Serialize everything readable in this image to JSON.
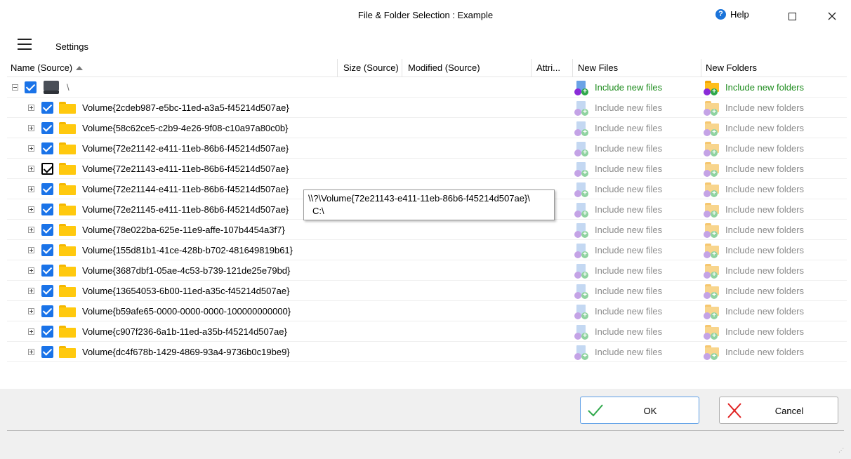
{
  "window": {
    "title": "File & Folder Selection : Example",
    "help_label": "Help"
  },
  "toolbar": {
    "settings_label": "Settings"
  },
  "columns": {
    "name": "Name (Source)",
    "size": "Size (Source)",
    "modified": "Modified (Source)",
    "attributes": "Attri...",
    "new_files": "New Files",
    "new_folders": "New Folders"
  },
  "root": {
    "name": "\\",
    "include_files": "Include new files",
    "include_folders": "Include new folders"
  },
  "rows": [
    {
      "name": "Volume{2cdeb987-e5bc-11ed-a3a5-f45214d507ae}",
      "files": "Include new files",
      "folders": "Include new folders"
    },
    {
      "name": "Volume{58c62ce5-c2b9-4e26-9f08-c10a97a80c0b}",
      "files": "Include new files",
      "folders": "Include new folders"
    },
    {
      "name": "Volume{72e21142-e411-11eb-86b6-f45214d507ae}",
      "files": "Include new files",
      "folders": "Include new folders"
    },
    {
      "name": "Volume{72e21143-e411-11eb-86b6-f45214d507ae}",
      "files": "Include new files",
      "folders": "Include new folders"
    },
    {
      "name": "Volume{72e21144-e411-11eb-86b6-f45214d507ae}",
      "files": "Include new files",
      "folders": "Include new folders"
    },
    {
      "name": "Volume{72e21145-e411-11eb-86b6-f45214d507ae}",
      "files": "Include new files",
      "folders": "Include new folders"
    },
    {
      "name": "Volume{78e022ba-625e-11e9-affe-107b4454a3f7}",
      "files": "Include new files",
      "folders": "Include new folders"
    },
    {
      "name": "Volume{155d81b1-41ce-428b-b702-481649819b61}",
      "files": "Include new files",
      "folders": "Include new folders"
    },
    {
      "name": "Volume{3687dbf1-05ae-4c53-b739-121de25e79bd}",
      "files": "Include new files",
      "folders": "Include new folders"
    },
    {
      "name": "Volume{13654053-6b00-11ed-a35c-f45214d507ae}",
      "files": "Include new files",
      "folders": "Include new folders"
    },
    {
      "name": "Volume{b59afe65-0000-0000-0000-100000000000}",
      "files": "Include new files",
      "folders": "Include new folders"
    },
    {
      "name": "Volume{c907f236-6a1b-11ed-a35b-f45214d507ae}",
      "files": "Include new files",
      "folders": "Include new folders"
    },
    {
      "name": "Volume{dc4f678b-1429-4869-93a4-9736b0c19be9}",
      "files": "Include new files",
      "folders": "Include new folders"
    }
  ],
  "tooltip": {
    "line1": "\\\\?\\Volume{72e21143-e411-11eb-86b6-f45214d507ae}\\",
    "line2": "C:\\"
  },
  "buttons": {
    "ok": "OK",
    "cancel": "Cancel"
  },
  "colors": {
    "accent": "#1a73e8",
    "active_green": "#1e8c1e",
    "inactive_gray": "#8c8c8c"
  }
}
